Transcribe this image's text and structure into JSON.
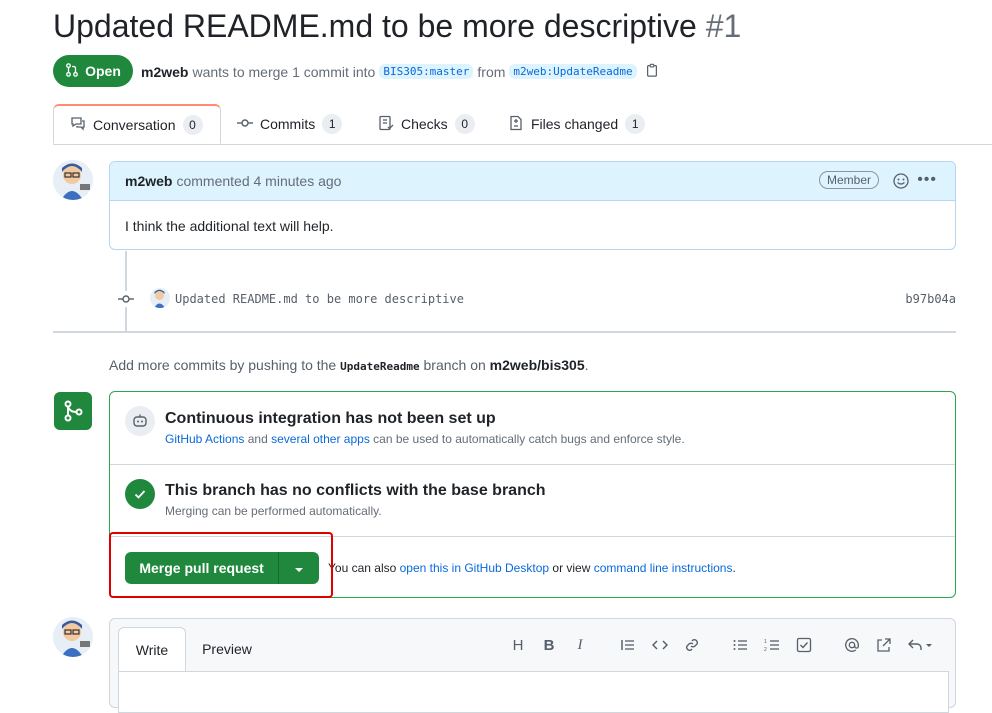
{
  "pr": {
    "title": "Updated README.md to be more descriptive",
    "number": "#1",
    "state": "Open",
    "author": "m2web",
    "merge_text_1": "wants to merge 1 commit into",
    "base_branch": "BIS305:master",
    "from_text": "from",
    "head_branch": "m2web:UpdateReadme"
  },
  "tabs": [
    {
      "label": "Conversation",
      "count": "0"
    },
    {
      "label": "Commits",
      "count": "1"
    },
    {
      "label": "Checks",
      "count": "0"
    },
    {
      "label": "Files changed",
      "count": "1"
    }
  ],
  "comment": {
    "author": "m2web",
    "meta": "commented 4 minutes ago",
    "badge": "Member",
    "body": "I think the additional text will help."
  },
  "commit": {
    "message": "Updated README.md to be more descriptive",
    "sha": "b97b04a"
  },
  "push_note": {
    "prefix": "Add more commits by pushing to the",
    "branch": "UpdateReadme",
    "mid": "branch on",
    "repo": "m2web/bis305",
    "suffix": "."
  },
  "ci": {
    "title": "Continuous integration has not been set up",
    "link1": "GitHub Actions",
    "and": "and",
    "link2": "several other apps",
    "rest": "can be used to automatically catch bugs and enforce style."
  },
  "conflicts": {
    "title": "This branch has no conflicts with the base branch",
    "sub": "Merging can be performed automatically."
  },
  "merge": {
    "button": "Merge pull request",
    "also": "You can also",
    "desktop_link": "open this in GitHub Desktop",
    "or_view": "or view",
    "cli_link": "command line instructions",
    "period": "."
  },
  "editor": {
    "tab_write": "Write",
    "tab_preview": "Preview",
    "tools": [
      "H",
      "B",
      "I"
    ]
  },
  "colors": {
    "primary": "#1f883d",
    "link": "#0969da",
    "highlight": "#e00000"
  }
}
